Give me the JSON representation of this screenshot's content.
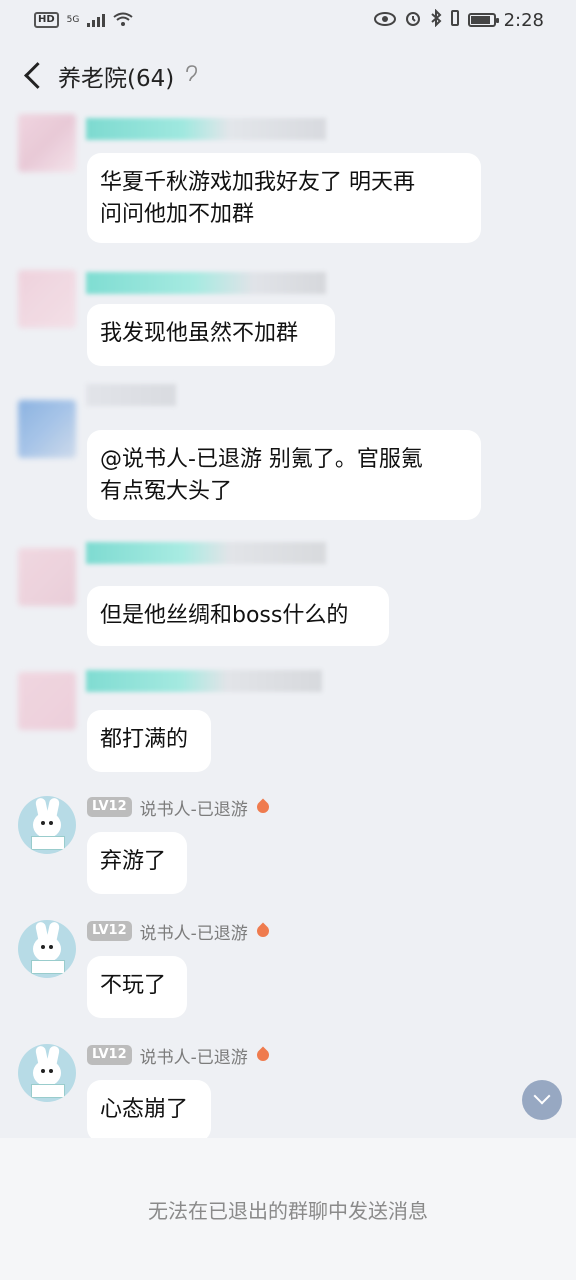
{
  "status_bar": {
    "left_badge": "HD",
    "network": "5G",
    "time": "2:28",
    "battery_level": 0.85
  },
  "header": {
    "back_icon": "back-arrow-icon",
    "title": "养老院(64)",
    "mute_icon": "ear-icon"
  },
  "messages": [
    {
      "text": "华夏千秋游戏加我好友了 明天再\n问问他加不加群",
      "sender_redacted": true
    },
    {
      "text": "我发现他虽然不加群",
      "sender_redacted": true
    },
    {
      "text": "@说书人-已退游 别氪了。官服氪\n有点冤大头了",
      "sender_redacted": true
    },
    {
      "text": "但是他丝绸和boss什么的",
      "sender_redacted": true
    },
    {
      "text": "都打满的",
      "sender_redacted": true
    },
    {
      "level": "LV12",
      "sender": "说书人-已退游",
      "badge_icon": "flame-icon",
      "text": "弃游了"
    },
    {
      "level": "LV12",
      "sender": "说书人-已退游",
      "badge_icon": "flame-icon",
      "text": "不玩了"
    },
    {
      "level": "LV12",
      "sender": "说书人-已退游",
      "badge_icon": "flame-icon",
      "text": "心态崩了"
    }
  ],
  "scroll_button_icon": "chevron-down-icon",
  "footer": {
    "notice": "无法在已退出的群聊中发送消息"
  },
  "colors": {
    "background": "#eef0f4",
    "bubble": "#ffffff",
    "level_badge": "#bcbcbc",
    "scroll_button": "#97a8c2",
    "flame": "#ef7b4e"
  }
}
